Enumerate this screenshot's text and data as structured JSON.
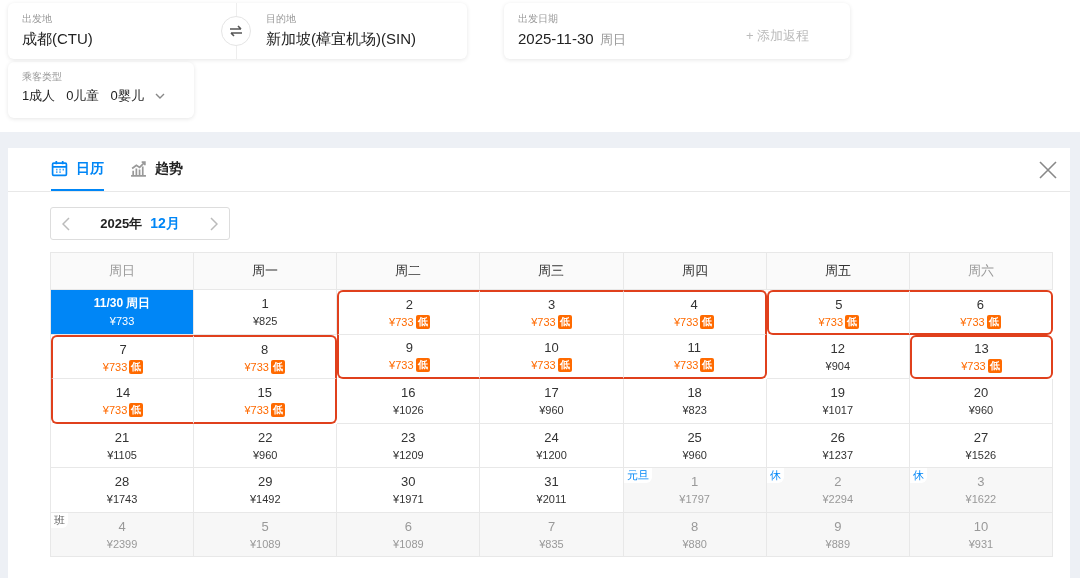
{
  "route": {
    "origin": {
      "label": "出发地",
      "value": "成都(CTU)"
    },
    "destination": {
      "label": "目的地",
      "value": "新加坡(樟宜机场)(SIN)"
    }
  },
  "date": {
    "label": "出发日期",
    "value": "2025-11-30",
    "weekday": "周日",
    "add_return": "+ 添加返程"
  },
  "passengers": {
    "label": "乘客类型",
    "items": [
      "1成人",
      "0儿童",
      "0婴儿"
    ]
  },
  "tabs": [
    {
      "label": "日历",
      "selected": true,
      "kind": "calendar"
    },
    {
      "label": "趋势",
      "selected": false,
      "kind": "trend"
    }
  ],
  "month_nav": {
    "year": "2025年",
    "month": "12月"
  },
  "weekdays": [
    {
      "label": "周日",
      "weekend": true
    },
    {
      "label": "周一",
      "weekend": false
    },
    {
      "label": "周二",
      "weekend": false
    },
    {
      "label": "周三",
      "weekend": false
    },
    {
      "label": "周四",
      "weekend": false
    },
    {
      "label": "周五",
      "weekend": false
    },
    {
      "label": "周六",
      "weekend": true
    }
  ],
  "weeks": [
    [
      {
        "day": "11/30 周日",
        "price": "¥733",
        "kind": "selected"
      },
      {
        "day": "1",
        "price": "¥825",
        "kind": "normal"
      },
      {
        "day": "2",
        "price": "¥733",
        "kind": "low",
        "badge": "低",
        "outline": {
          "top": true,
          "right": false,
          "bottom": false,
          "left": true
        }
      },
      {
        "day": "3",
        "price": "¥733",
        "kind": "low",
        "badge": "低",
        "outline": {
          "top": true,
          "right": false,
          "bottom": false,
          "left": false
        }
      },
      {
        "day": "4",
        "price": "¥733",
        "kind": "low",
        "badge": "低",
        "outline": {
          "top": true,
          "right": true,
          "bottom": false,
          "left": false
        }
      },
      {
        "day": "5",
        "price": "¥733",
        "kind": "low",
        "badge": "低",
        "outline": {
          "top": true,
          "right": false,
          "bottom": true,
          "left": true
        }
      },
      {
        "day": "6",
        "price": "¥733",
        "kind": "low",
        "badge": "低",
        "outline": {
          "top": true,
          "right": true,
          "bottom": true,
          "left": false
        }
      }
    ],
    [
      {
        "day": "7",
        "price": "¥733",
        "kind": "low",
        "badge": "低",
        "outline": {
          "top": true,
          "right": false,
          "bottom": false,
          "left": true
        }
      },
      {
        "day": "8",
        "price": "¥733",
        "kind": "low",
        "badge": "低",
        "outline": {
          "top": true,
          "right": true,
          "bottom": false,
          "left": false
        }
      },
      {
        "day": "9",
        "price": "¥733",
        "kind": "low",
        "badge": "低",
        "outline": {
          "top": false,
          "right": false,
          "bottom": true,
          "left": true
        }
      },
      {
        "day": "10",
        "price": "¥733",
        "kind": "low",
        "badge": "低",
        "outline": {
          "top": false,
          "right": false,
          "bottom": true,
          "left": false
        }
      },
      {
        "day": "11",
        "price": "¥733",
        "kind": "low",
        "badge": "低",
        "outline": {
          "top": false,
          "right": true,
          "bottom": true,
          "left": false
        }
      },
      {
        "day": "12",
        "price": "¥904",
        "kind": "normal"
      },
      {
        "day": "13",
        "price": "¥733",
        "kind": "low",
        "badge": "低",
        "outline": {
          "top": true,
          "right": true,
          "bottom": true,
          "left": true
        }
      }
    ],
    [
      {
        "day": "14",
        "price": "¥733",
        "kind": "low",
        "badge": "低",
        "outline": {
          "top": false,
          "right": false,
          "bottom": true,
          "left": true
        }
      },
      {
        "day": "15",
        "price": "¥733",
        "kind": "low",
        "badge": "低",
        "outline": {
          "top": false,
          "right": true,
          "bottom": true,
          "left": false
        }
      },
      {
        "day": "16",
        "price": "¥1026",
        "kind": "normal"
      },
      {
        "day": "17",
        "price": "¥960",
        "kind": "normal"
      },
      {
        "day": "18",
        "price": "¥823",
        "kind": "normal"
      },
      {
        "day": "19",
        "price": "¥1017",
        "kind": "normal"
      },
      {
        "day": "20",
        "price": "¥960",
        "kind": "normal"
      }
    ],
    [
      {
        "day": "21",
        "price": "¥1105",
        "kind": "normal"
      },
      {
        "day": "22",
        "price": "¥960",
        "kind": "normal"
      },
      {
        "day": "23",
        "price": "¥1209",
        "kind": "normal"
      },
      {
        "day": "24",
        "price": "¥1200",
        "kind": "normal"
      },
      {
        "day": "25",
        "price": "¥960",
        "kind": "normal"
      },
      {
        "day": "26",
        "price": "¥1237",
        "kind": "normal"
      },
      {
        "day": "27",
        "price": "¥1526",
        "kind": "normal"
      }
    ],
    [
      {
        "day": "28",
        "price": "¥1743",
        "kind": "normal"
      },
      {
        "day": "29",
        "price": "¥1492",
        "kind": "normal"
      },
      {
        "day": "30",
        "price": "¥1971",
        "kind": "normal"
      },
      {
        "day": "31",
        "price": "¥2011",
        "kind": "normal"
      },
      {
        "day": "1",
        "price": "¥1797",
        "kind": "outside",
        "tag": "元旦",
        "tag_holiday": true
      },
      {
        "day": "2",
        "price": "¥2294",
        "kind": "outside",
        "tag": "休",
        "tag_holiday": true
      },
      {
        "day": "3",
        "price": "¥1622",
        "kind": "outside",
        "tag": "休",
        "tag_holiday": true
      }
    ],
    [
      {
        "day": "4",
        "price": "¥2399",
        "kind": "outside",
        "tag": "班",
        "tag_holiday": false
      },
      {
        "day": "5",
        "price": "¥1089",
        "kind": "outside"
      },
      {
        "day": "6",
        "price": "¥1089",
        "kind": "outside"
      },
      {
        "day": "7",
        "price": "¥835",
        "kind": "outside"
      },
      {
        "day": "8",
        "price": "¥880",
        "kind": "outside"
      },
      {
        "day": "9",
        "price": "¥889",
        "kind": "outside"
      },
      {
        "day": "10",
        "price": "¥931",
        "kind": "outside"
      }
    ]
  ]
}
